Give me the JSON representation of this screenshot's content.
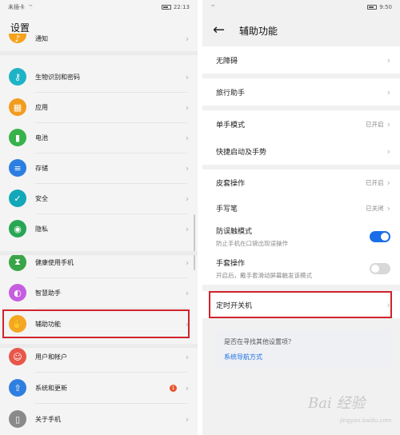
{
  "left": {
    "status": {
      "carrier": "未插卡",
      "time": "22:13"
    },
    "title": "设置",
    "items": [
      {
        "label": "通知",
        "icon": "bell-icon",
        "color": "#f6a21b"
      },
      {
        "label": "生物识别和密码",
        "icon": "key-icon",
        "color": "#1fb3c7"
      },
      {
        "label": "应用",
        "icon": "apps-icon",
        "color": "#f29c1f"
      },
      {
        "label": "电池",
        "icon": "battery-icon",
        "color": "#38b24a"
      },
      {
        "label": "存储",
        "icon": "storage-icon",
        "color": "#2c7ee0"
      },
      {
        "label": "安全",
        "icon": "shield-icon",
        "color": "#13a8b8"
      },
      {
        "label": "隐私",
        "icon": "privacy-icon",
        "color": "#28a653"
      },
      {
        "label": "健康使用手机",
        "icon": "hourglass-icon",
        "color": "#3aa548"
      },
      {
        "label": "智慧助手",
        "icon": "assistant-icon",
        "color": "#c65de0"
      },
      {
        "label": "辅助功能",
        "icon": "hand-icon",
        "color": "#f5a623"
      },
      {
        "label": "用户和帐户",
        "icon": "user-icon",
        "color": "#e8574b"
      },
      {
        "label": "系统和更新",
        "icon": "phone-update-icon",
        "color": "#2f7fe0",
        "badge": "1"
      },
      {
        "label": "关于手机",
        "icon": "phone-icon",
        "color": "#8a8a8a"
      }
    ]
  },
  "right": {
    "status": {
      "time": "9:50"
    },
    "title": "辅助功能",
    "items": [
      {
        "label": "无障碍"
      },
      {
        "label": "旅行助手"
      },
      {
        "label": "单手模式",
        "value": "已开启"
      },
      {
        "label": "快捷启动及手势"
      },
      {
        "label": "皮套操作",
        "value": "已开启"
      },
      {
        "label": "手写笔",
        "value": "已关闭"
      },
      {
        "label": "防误触模式",
        "desc": "防止手机在口袋出现误操作",
        "toggle": true
      },
      {
        "label": "手套操作",
        "desc": "开启后，戴手套滑动屏幕触发该模式",
        "toggle": false
      },
      {
        "label": "定时开关机"
      }
    ],
    "suggest": {
      "question": "是否在寻找其他设置项？",
      "link": "系统导航方式"
    },
    "watermark": "Bai 经验",
    "watermark_sub": "jingyan.baidu.com"
  },
  "icons": {
    "back": "arrow-left-icon",
    "chevron": "chevron-right-icon"
  }
}
